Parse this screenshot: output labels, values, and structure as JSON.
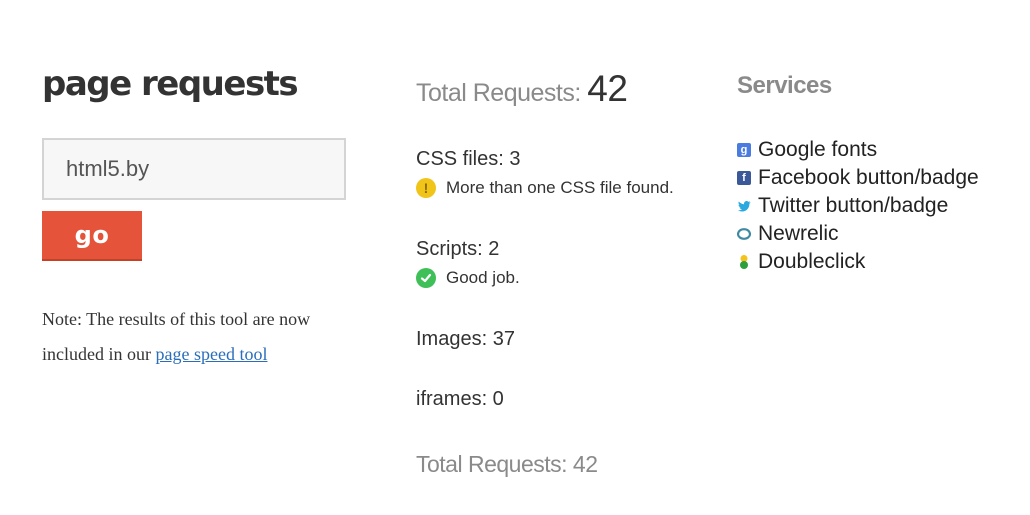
{
  "header": {
    "title": "page requests"
  },
  "form": {
    "url_value": "html5.by",
    "go_label": "go"
  },
  "note": {
    "text_before": "Note: The results of this tool are now included in our ",
    "link_text": "page speed tool"
  },
  "summary": {
    "total_label": "Total Requests: ",
    "total_value": "42",
    "css": {
      "label": "CSS files: 3",
      "message": "More than one CSS file found.",
      "status": "warning"
    },
    "scripts": {
      "label": "Scripts: 2",
      "message": "Good job.",
      "status": "ok"
    },
    "images": {
      "label": "Images: 37"
    },
    "iframes": {
      "label": "iframes: 0"
    },
    "total_bottom": "Total Requests: 42"
  },
  "services": {
    "title": "Services",
    "items": [
      {
        "label": "Google fonts",
        "icon": "google-icon"
      },
      {
        "label": "Facebook button/badge",
        "icon": "facebook-icon"
      },
      {
        "label": "Twitter button/badge",
        "icon": "twitter-icon"
      },
      {
        "label": "Newrelic",
        "icon": "newrelic-icon"
      },
      {
        "label": "Doubleclick",
        "icon": "doubleclick-icon"
      }
    ]
  },
  "colors": {
    "accent": "#e5533a",
    "link": "#2a6ebb",
    "warning": "#f0c419",
    "ok": "#3fbf57",
    "muted": "#8a8a8a"
  }
}
